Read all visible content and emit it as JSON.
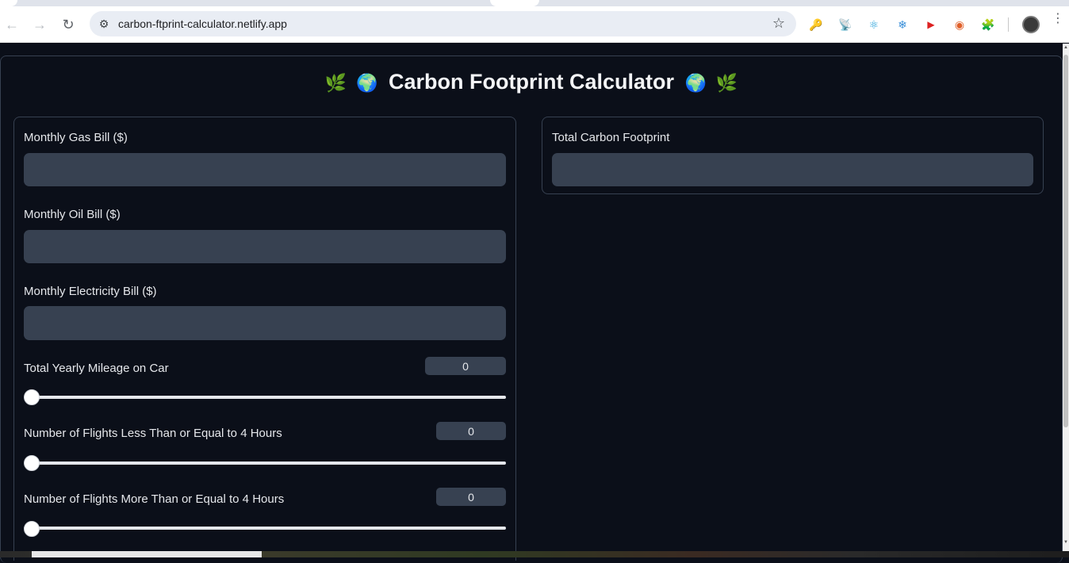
{
  "browser": {
    "url": "carbon-ftprint-calculator.netlify.app",
    "back_icon": "←",
    "forward_icon": "→",
    "reload_icon": "↻",
    "site_info_icon": "⚙",
    "bookmark_icon": "☆",
    "menu_icon": "⋮",
    "extensions": [
      {
        "name": "key-extension-icon",
        "glyph": "🔑"
      },
      {
        "name": "satellite-extension-icon",
        "glyph": "📡"
      },
      {
        "name": "react-extension-icon",
        "glyph": "⚛"
      },
      {
        "name": "snowflake-extension-icon",
        "glyph": "❄"
      },
      {
        "name": "video-extension-icon",
        "glyph": "▶"
      },
      {
        "name": "circle-extension-icon",
        "glyph": "◉"
      },
      {
        "name": "puzzle-extensions-icon",
        "glyph": "🧩"
      }
    ]
  },
  "app": {
    "title": "Carbon Footprint Calculator",
    "leaf_emoji": "🌿",
    "globe_emoji": "🌍"
  },
  "inputs": {
    "gas_label": "Monthly Gas Bill ($)",
    "gas_value": "",
    "oil_label": "Monthly Oil Bill ($)",
    "oil_value": "",
    "electricity_label": "Monthly Electricity Bill ($)",
    "electricity_value": ""
  },
  "sliders": {
    "mileage_label": "Total Yearly Mileage on Car",
    "mileage_value": "0",
    "short_flights_label": "Number of Flights Less Than or Equal to 4 Hours",
    "short_flights_value": "0",
    "long_flights_label": "Number of Flights More Than or Equal to 4 Hours",
    "long_flights_value": "0"
  },
  "output": {
    "total_label": "Total Carbon Footprint",
    "total_value": ""
  },
  "colors": {
    "background": "#0b0f19",
    "input_bg": "#374151",
    "border": "#374151",
    "text": "#e5e7eb"
  }
}
